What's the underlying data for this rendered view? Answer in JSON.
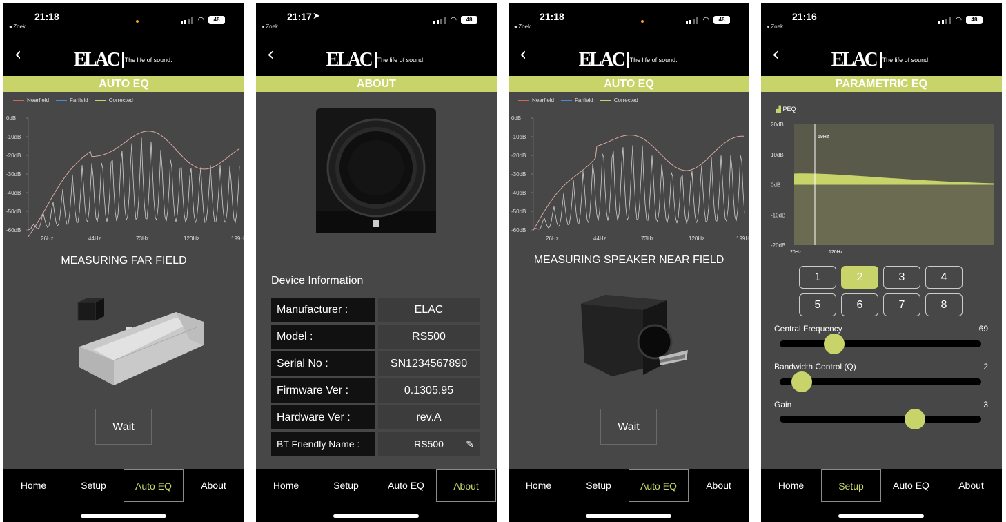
{
  "colors": {
    "accent": "#c8d46a",
    "nearfield": "#c96a5a",
    "farfield": "#4a8ad8",
    "corrected": "#c8d46a"
  },
  "brand": {
    "logo": "ELAC",
    "tagline": "The life of sound."
  },
  "tabs": [
    "Home",
    "Setup",
    "Auto EQ",
    "About"
  ],
  "screens": [
    {
      "status": {
        "time": "21:18",
        "back_app": "◂ Zoek",
        "battery": "48"
      },
      "section_title": "AUTO EQ",
      "legend": [
        "Nearfield",
        "Farfield",
        "Corrected"
      ],
      "caption": "MEASURING FAR FIELD",
      "button": "Wait",
      "active_tab": "Auto EQ"
    },
    {
      "status": {
        "time": "21:17",
        "back_app": "◂ Zoek",
        "battery": "48"
      },
      "section_title": "ABOUT",
      "device_title": "Device Information",
      "info": [
        {
          "key": "Manufacturer :",
          "value": "ELAC"
        },
        {
          "key": "Model :",
          "value": "RS500"
        },
        {
          "key": "Serial No :",
          "value": "SN1234567890"
        },
        {
          "key": "Firmware Ver :",
          "value": "0.1305.95"
        },
        {
          "key": "Hardware Ver :",
          "value": "rev.A"
        },
        {
          "key": "BT Friendly Name :",
          "value": "RS500"
        }
      ],
      "active_tab": "About"
    },
    {
      "status": {
        "time": "21:18",
        "back_app": "◂ Zoek",
        "battery": "48"
      },
      "section_title": "AUTO EQ",
      "legend": [
        "Nearfield",
        "Farfield",
        "Corrected"
      ],
      "caption": "MEASURING SPEAKER NEAR FIELD",
      "button": "Wait",
      "active_tab": "Auto EQ"
    },
    {
      "status": {
        "time": "21:16",
        "back_app": "◂ Zoek",
        "battery": "48"
      },
      "section_title": "PARAMETRIC EQ",
      "peq_label": "PEQ",
      "filter_buttons": [
        "1",
        "2",
        "3",
        "4",
        "5",
        "6",
        "7",
        "8"
      ],
      "selected_filter": "2",
      "sliders": [
        {
          "label": "Central Frequency",
          "value": "69",
          "fraction": 0.27
        },
        {
          "label": "Bandwidth Control (Q)",
          "value": "2",
          "fraction": 0.11
        },
        {
          "label": "Gain",
          "value": "3",
          "fraction": 0.67
        }
      ],
      "active_tab": "Setup"
    }
  ],
  "chart_data": [
    {
      "type": "line",
      "ylabels": [
        "0dB",
        "-10dB",
        "-20dB",
        "-30dB",
        "-40dB",
        "-50dB",
        "-60dB"
      ],
      "xlabels": [
        "26Hz",
        "44Hz",
        "73Hz",
        "120Hz",
        "199Hz"
      ],
      "ylim": [
        -60,
        0
      ],
      "legend": [
        "Nearfield",
        "Farfield",
        "Corrected"
      ],
      "grid": false
    },
    {
      "type": "line",
      "ylabels": [
        "0dB",
        "-10dB",
        "-20dB",
        "-30dB",
        "-40dB",
        "-50dB",
        "-60dB"
      ],
      "xlabels": [
        "26Hz",
        "44Hz",
        "73Hz",
        "120Hz",
        "199Hz"
      ],
      "ylim": [
        -60,
        0
      ],
      "legend": [
        "Nearfield",
        "Farfield",
        "Corrected"
      ],
      "grid": false
    },
    {
      "type": "area",
      "ylabels": [
        "20dB",
        "10dB",
        "0dB",
        "-10dB",
        "-20dB"
      ],
      "xlabels": [
        "20Hz",
        "120Hz"
      ],
      "ylim": [
        -20,
        20
      ],
      "marker_label": "69Hz",
      "series": [
        {
          "name": "PEQ"
        }
      ]
    }
  ]
}
